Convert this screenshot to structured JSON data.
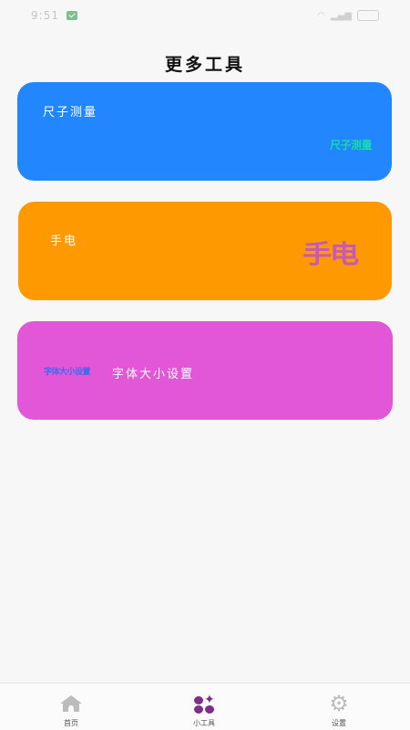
{
  "status_bar": {
    "time": "9:51"
  },
  "header": {
    "title": "更多工具"
  },
  "cards": {
    "ruler": {
      "label": "尺子测量",
      "art": "尺子测量"
    },
    "flashlight": {
      "label": "手电",
      "art": "手电"
    },
    "font_size": {
      "label": "字体大小设置",
      "art": "字体大小设置"
    }
  },
  "tab_bar": {
    "home": "首页",
    "tools": "小工具",
    "settings": "设置"
  },
  "colors": {
    "ruler_card": "#2287fe",
    "flashlight_card": "#fe9902",
    "font_card": "#e157d8",
    "active_tab": "#7d2d8c"
  }
}
